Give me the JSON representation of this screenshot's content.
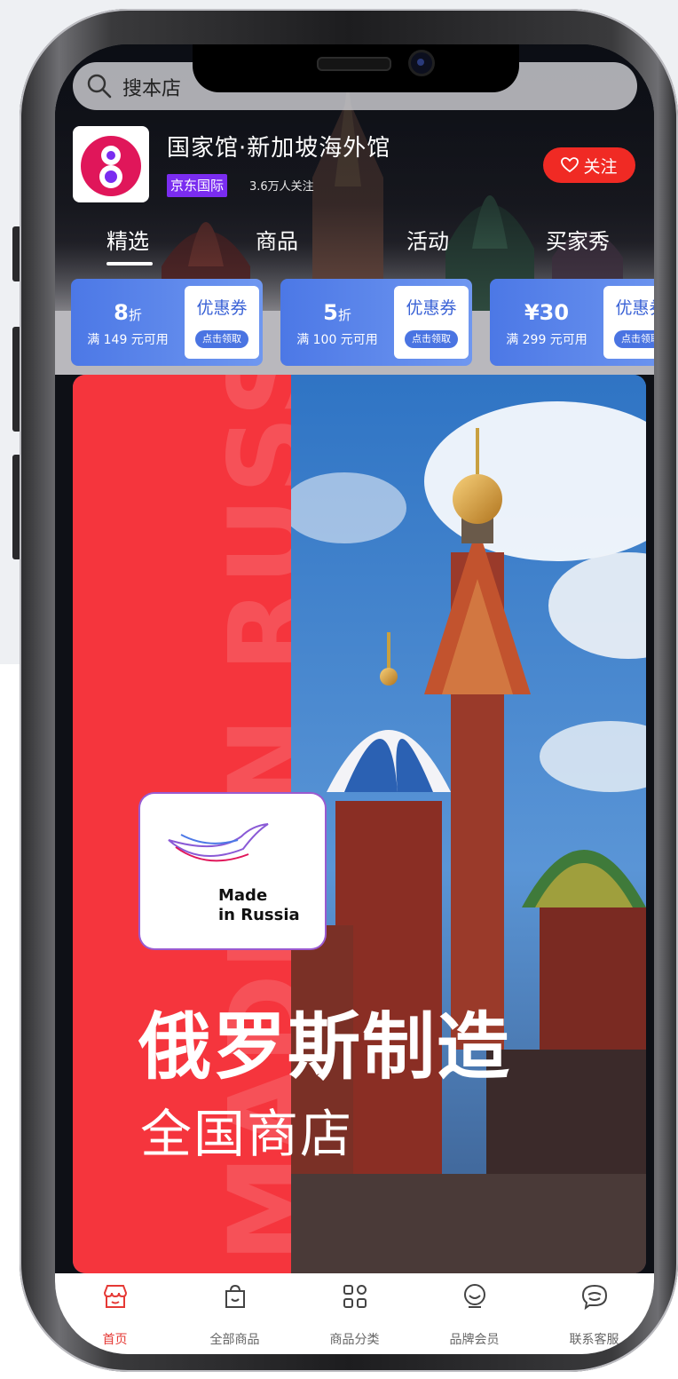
{
  "search": {
    "placeholder": "搜本店"
  },
  "store": {
    "name": "国家馆·新加坡海外馆",
    "badge": "京东国际",
    "followers": "3.6万人关注",
    "follow_label": "关注"
  },
  "tabs": [
    {
      "label": "精选",
      "active": true
    },
    {
      "label": "商品",
      "active": false
    },
    {
      "label": "活动",
      "active": false
    },
    {
      "label": "买家秀",
      "active": false
    }
  ],
  "coupons": [
    {
      "amount": "8",
      "unit": "折",
      "condition": "满 149 元可用",
      "title": "优惠券",
      "action": "点击领取"
    },
    {
      "amount": "5",
      "unit": "折",
      "condition": "满 100 元可用",
      "title": "优惠券",
      "action": "点击领取"
    },
    {
      "amount": "¥30",
      "unit": "",
      "condition": "满 299 元可用",
      "title": "优惠券",
      "action": "点击领取"
    }
  ],
  "banner": {
    "watermark": "MADE IN RUSSIA",
    "logo_text": "Made\nin Russia",
    "title": "俄罗斯制造",
    "subtitle": "全国商店"
  },
  "bottom_nav": [
    {
      "label": "首页",
      "icon": "store-icon",
      "active": true
    },
    {
      "label": "全部商品",
      "icon": "bag-icon",
      "active": false
    },
    {
      "label": "商品分类",
      "icon": "grid-icon",
      "active": false
    },
    {
      "label": "品牌会员",
      "icon": "member-icon",
      "active": false
    },
    {
      "label": "联系客服",
      "icon": "chat-icon",
      "active": false
    }
  ],
  "colors": {
    "accent": "#f02a24",
    "coupon_blue": "#4c78e6",
    "banner_red": "#f5353d",
    "badge_purple": "#7a2cf0"
  }
}
